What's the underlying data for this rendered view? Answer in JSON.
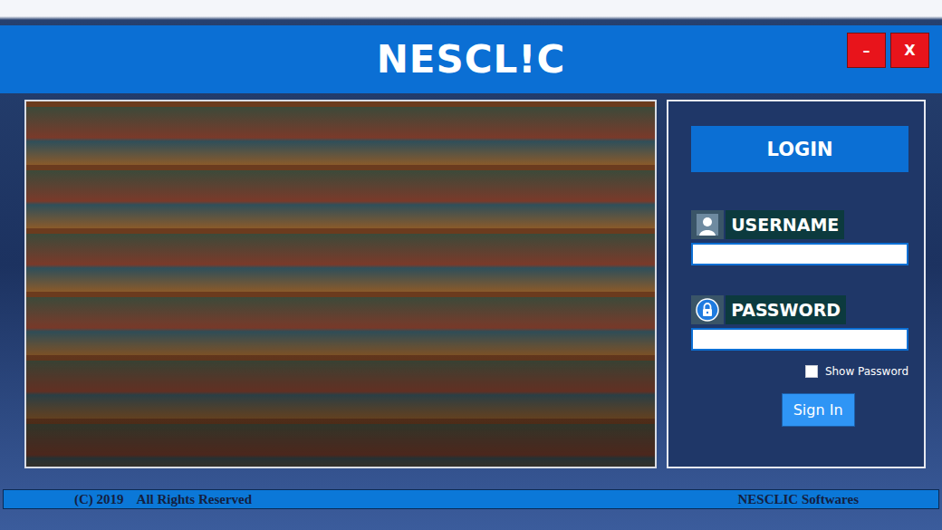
{
  "window": {
    "title": "NESCL!C",
    "controls": [
      "–",
      "X"
    ]
  },
  "login": {
    "heading": "LOGIN",
    "fields": [
      {
        "label": "USERNAME",
        "kind": "text",
        "value": ""
      },
      {
        "label": "PASSWORD",
        "kind": "password",
        "value": ""
      }
    ],
    "show_password": {
      "label": "Show Password",
      "checked": false
    },
    "submit": "Sign In"
  },
  "footer": {
    "copyright": "(C) 2019",
    "rights": "All Rights Reserved",
    "company": "NESCLIC Softwares"
  }
}
